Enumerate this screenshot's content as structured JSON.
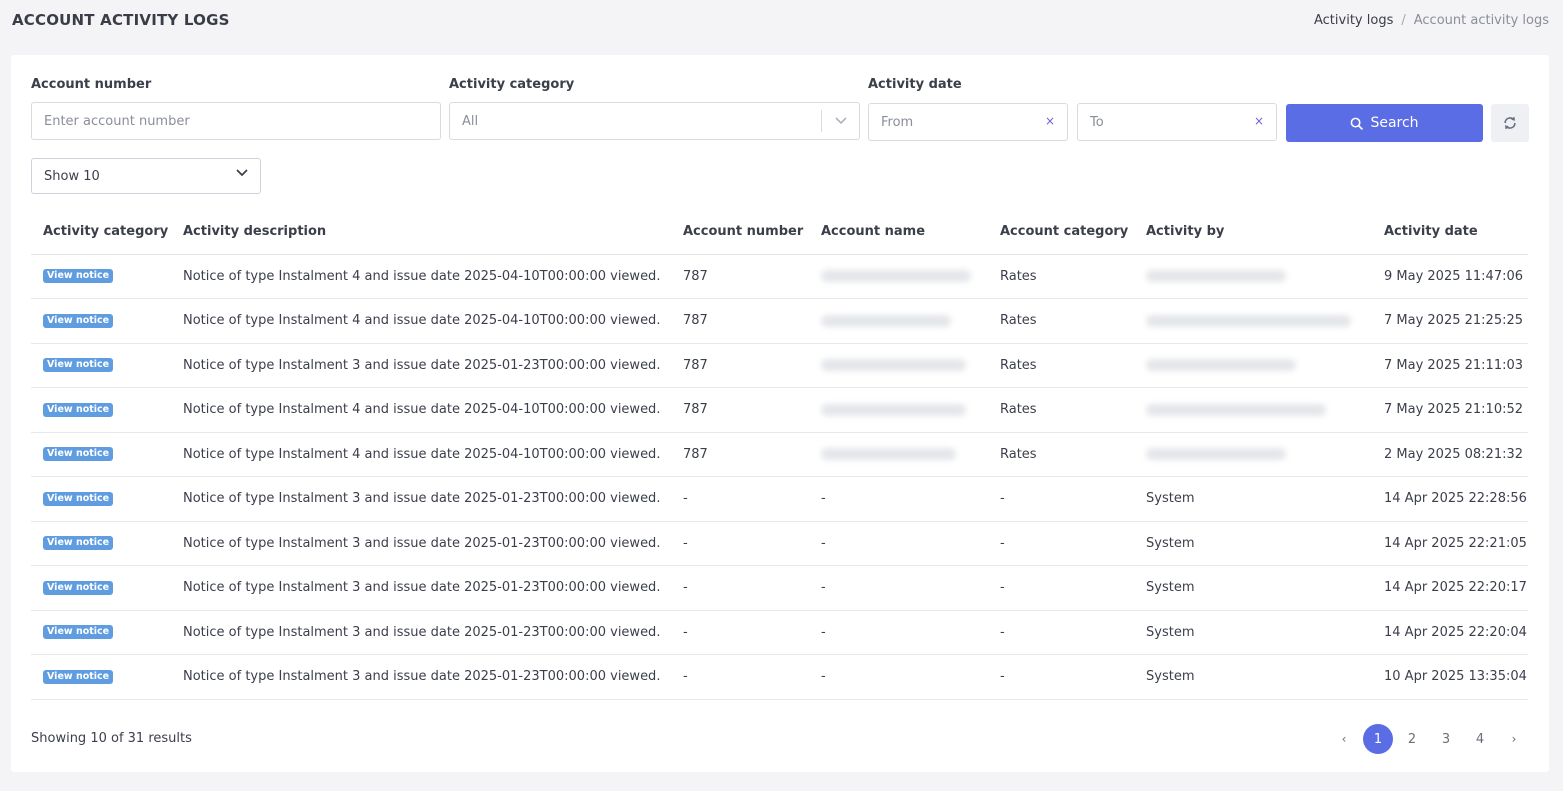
{
  "header": {
    "title": "ACCOUNT ACTIVITY LOGS",
    "breadcrumb": {
      "link": "Activity logs",
      "separator": "/",
      "current": "Account activity logs"
    }
  },
  "filters": {
    "account_number": {
      "label": "Account number",
      "placeholder": "Enter account number"
    },
    "activity_category": {
      "label": "Activity category",
      "value": "All"
    },
    "activity_date": {
      "label": "Activity date",
      "from_placeholder": "From",
      "to_placeholder": "To",
      "clear_glyph": "×"
    },
    "search_label": "Search"
  },
  "page_size": {
    "label": "Show 10"
  },
  "table": {
    "columns": [
      "Activity category",
      "Activity description",
      "Account number",
      "Account name",
      "Account category",
      "Activity by",
      "Activity date"
    ],
    "rows": [
      {
        "category": "View notice",
        "description": "Notice of type Instalment 4 and issue date 2025-04-10T00:00:00 viewed.",
        "account_number": "787",
        "account_name": "",
        "account_category": "Rates",
        "activity_by": "",
        "date": "9 May 2025 11:47:06"
      },
      {
        "category": "View notice",
        "description": "Notice of type Instalment 4 and issue date 2025-04-10T00:00:00 viewed.",
        "account_number": "787",
        "account_name": "",
        "account_category": "Rates",
        "activity_by": "",
        "date": "7 May 2025 21:25:25"
      },
      {
        "category": "View notice",
        "description": "Notice of type Instalment 3 and issue date 2025-01-23T00:00:00 viewed.",
        "account_number": "787",
        "account_name": "",
        "account_category": "Rates",
        "activity_by": "",
        "date": "7 May 2025 21:11:03"
      },
      {
        "category": "View notice",
        "description": "Notice of type Instalment 4 and issue date 2025-04-10T00:00:00 viewed.",
        "account_number": "787",
        "account_name": "",
        "account_category": "Rates",
        "activity_by": "",
        "date": "7 May 2025 21:10:52"
      },
      {
        "category": "View notice",
        "description": "Notice of type Instalment 4 and issue date 2025-04-10T00:00:00 viewed.",
        "account_number": "787",
        "account_name": "",
        "account_category": "Rates",
        "activity_by": "",
        "date": "2 May 2025 08:21:32"
      },
      {
        "category": "View notice",
        "description": "Notice of type Instalment 3 and issue date 2025-01-23T00:00:00 viewed.",
        "account_number": "-",
        "account_name": "-",
        "account_category": "-",
        "activity_by": "System",
        "date": "14 Apr 2025 22:28:56"
      },
      {
        "category": "View notice",
        "description": "Notice of type Instalment 3 and issue date 2025-01-23T00:00:00 viewed.",
        "account_number": "-",
        "account_name": "-",
        "account_category": "-",
        "activity_by": "System",
        "date": "14 Apr 2025 22:21:05"
      },
      {
        "category": "View notice",
        "description": "Notice of type Instalment 3 and issue date 2025-01-23T00:00:00 viewed.",
        "account_number": "-",
        "account_name": "-",
        "account_category": "-",
        "activity_by": "System",
        "date": "14 Apr 2025 22:20:17"
      },
      {
        "category": "View notice",
        "description": "Notice of type Instalment 3 and issue date 2025-01-23T00:00:00 viewed.",
        "account_number": "-",
        "account_name": "-",
        "account_category": "-",
        "activity_by": "System",
        "date": "14 Apr 2025 22:20:04"
      },
      {
        "category": "View notice",
        "description": "Notice of type Instalment 3 and issue date 2025-01-23T00:00:00 viewed.",
        "account_number": "-",
        "account_name": "-",
        "account_category": "-",
        "activity_by": "System",
        "date": "10 Apr 2025 13:35:04"
      }
    ]
  },
  "footer": {
    "summary": "Showing 10 of 31 results",
    "pages": [
      "1",
      "2",
      "3",
      "4"
    ],
    "current_page": "1",
    "prev_glyph": "‹",
    "next_glyph": "›"
  },
  "colors": {
    "primary": "#5a6de4",
    "badge": "#5f9de0",
    "clear_icon": "#7a5cd6"
  },
  "icons": {
    "search": "search-icon",
    "reset": "refresh-icon",
    "dropdown": "chevron-down-icon"
  }
}
